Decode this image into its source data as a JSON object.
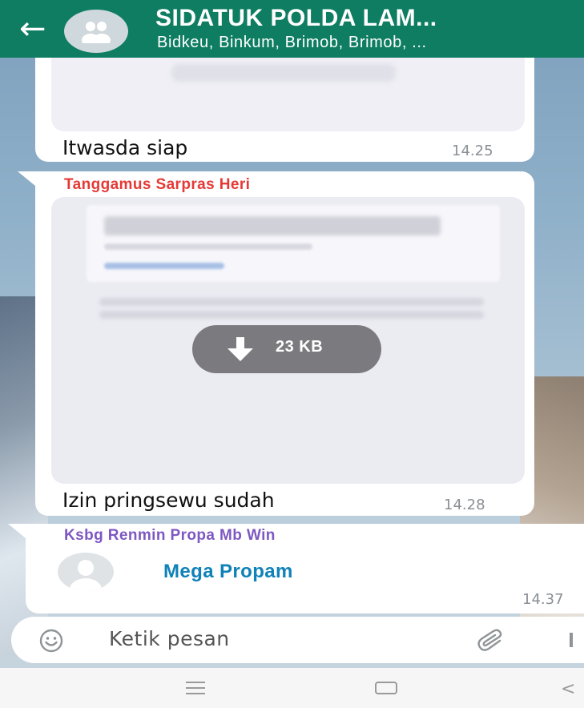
{
  "header": {
    "title": "SIDATUK POLDA LAM...",
    "subtitle": "Bidkeu, Binkum, Brimob, Brimob, ...",
    "back_icon": "arrow-left-icon",
    "avatar_icon": "group-avatar-icon"
  },
  "messages": [
    {
      "type": "image",
      "text": "Itwasda siap",
      "time": "14.25"
    },
    {
      "type": "document",
      "sender": "Tanggamus Sarpras Heri",
      "sender_color": "#e53935",
      "download_size": "23 KB",
      "text": "Izin pringsewu sudah",
      "time": "14.28"
    },
    {
      "type": "contact",
      "sender": "Ksbg Renmin Propa Mb Win",
      "sender_color": "#7e57c2",
      "contact_name": "Mega Propam",
      "time": "14.37"
    }
  ],
  "composer": {
    "placeholder": "Ketik pesan",
    "emoji_icon": "emoji-icon",
    "attach_icon": "paperclip-icon"
  },
  "colors": {
    "header_bg": "#0e7d62",
    "contact_name": "#0f82b8"
  }
}
